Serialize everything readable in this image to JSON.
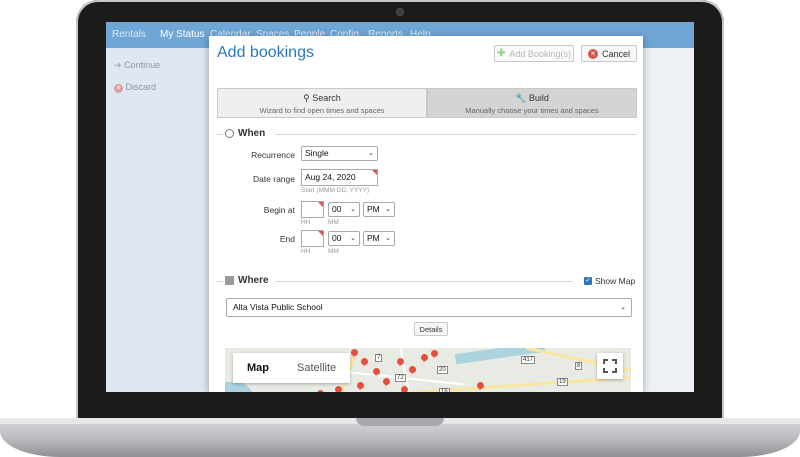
{
  "app_nav": {
    "items": [
      "Rentals",
      "My Status",
      "Calendar",
      "Spaces",
      "People",
      "Config",
      "Reports",
      "Help"
    ]
  },
  "sidebar": {
    "items": [
      {
        "label": "Continue",
        "icon": "arrow-right-icon"
      },
      {
        "label": "Discard",
        "icon": "close-circle-icon"
      }
    ]
  },
  "dialog": {
    "title": "Add bookings",
    "add_button": "Add Booking(s)",
    "cancel_button": "Cancel",
    "tabs": [
      {
        "label": "Search",
        "sub": "Wizard to find open times and spaces",
        "icon": "search-icon"
      },
      {
        "label": "Build",
        "sub": "Manually choose your times and spaces",
        "icon": "wrench-icon"
      }
    ]
  },
  "when": {
    "heading": "When",
    "recurrence_label": "Recurrence",
    "recurrence_value": "Single",
    "date_range_label": "Date range",
    "date_value": "Aug 24, 2020",
    "date_hint": "Start (MMM DD, YYYY)",
    "begin_label": "Begin at",
    "end_label": "End",
    "begin": {
      "hour": "",
      "minute": "00",
      "ampm": "PM"
    },
    "end": {
      "hour": "",
      "minute": "00",
      "ampm": "PM"
    },
    "hh_hint": "HH",
    "mm_hint": "MM"
  },
  "where": {
    "heading": "Where",
    "show_map_label": "Show Map",
    "show_map_checked": true,
    "location_value": "Alta Vista Public School",
    "details_button": "Details"
  },
  "map": {
    "tabs": [
      "Map",
      "Satellite"
    ],
    "active_tab": "Map",
    "road_labels": [
      "417",
      "7",
      "7",
      "72",
      "20",
      "16",
      "2",
      "19",
      "8"
    ]
  },
  "colors": {
    "accent": "#2c78bd",
    "nav": "#6fa6d6",
    "danger": "#d9534f",
    "pin": "#e84d3d"
  }
}
